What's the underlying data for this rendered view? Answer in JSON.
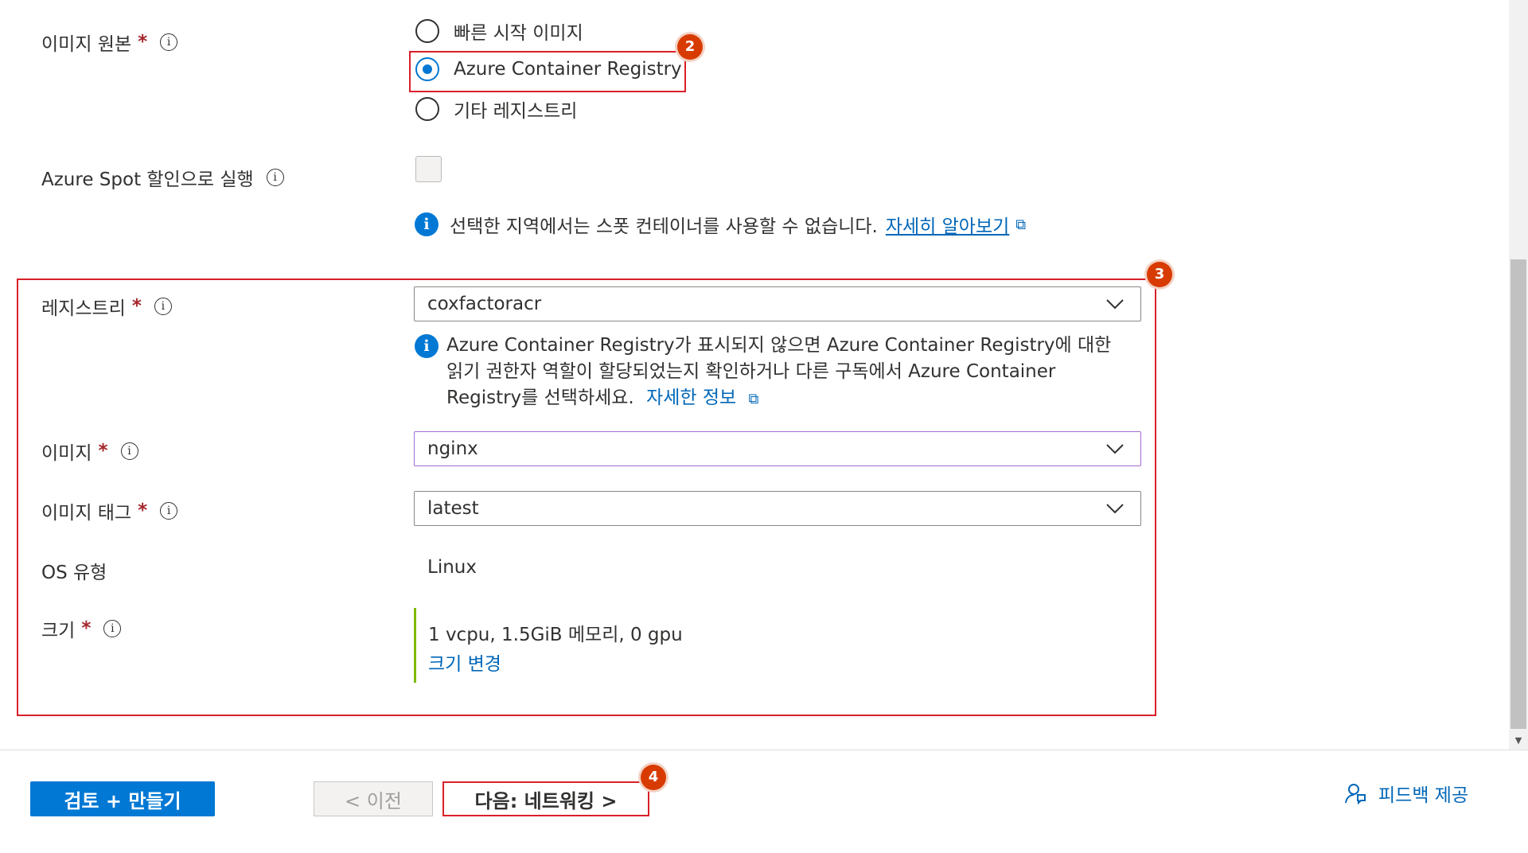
{
  "image_source": {
    "label": "이미지 원본",
    "required_mark": "*",
    "options": [
      {
        "label": "빠른 시작 이미지",
        "selected": false
      },
      {
        "label": "Azure Container Registry",
        "selected": true
      },
      {
        "label": "기타 레지스트리",
        "selected": false
      }
    ]
  },
  "spot": {
    "label": "Azure Spot 할인으로 실행",
    "checked": false,
    "info_text": "선택한 지역에서는 스폿 컨테이너를 사용할 수 없습니다.",
    "info_link": "자세히 알아보기"
  },
  "registry": {
    "label": "레지스트리",
    "required_mark": "*",
    "value": "coxfactoracr",
    "info_line1": "Azure Container Registry가 표시되지 않으면 Azure Container Registry에 대한",
    "info_line2": "읽기 권한자 역할이 할당되었는지 확인하거나 다른 구독에서 Azure Container",
    "info_line3": "Registry를 선택하세요.",
    "info_link": "자세한 정보"
  },
  "image": {
    "label": "이미지",
    "required_mark": "*",
    "value": "nginx"
  },
  "image_tag": {
    "label": "이미지 태그",
    "required_mark": "*",
    "value": "latest"
  },
  "os_type": {
    "label": "OS 유형",
    "value": "Linux"
  },
  "size": {
    "label": "크기",
    "required_mark": "*",
    "value": "1 vcpu, 1.5GiB 메모리, 0 gpu",
    "change_link": "크기 변경"
  },
  "badges": {
    "b2": "2",
    "b3": "3",
    "b4": "4"
  },
  "footer": {
    "review_button": "검토 + 만들기",
    "prev_button": "< 이전",
    "next_button": "다음: 네트워킹 >",
    "feedback": "피드백 제공"
  },
  "colors": {
    "accent": "#0078d4",
    "callout": "#d9202a",
    "badge": "#d83b01",
    "size_bar": "#7fba00"
  }
}
